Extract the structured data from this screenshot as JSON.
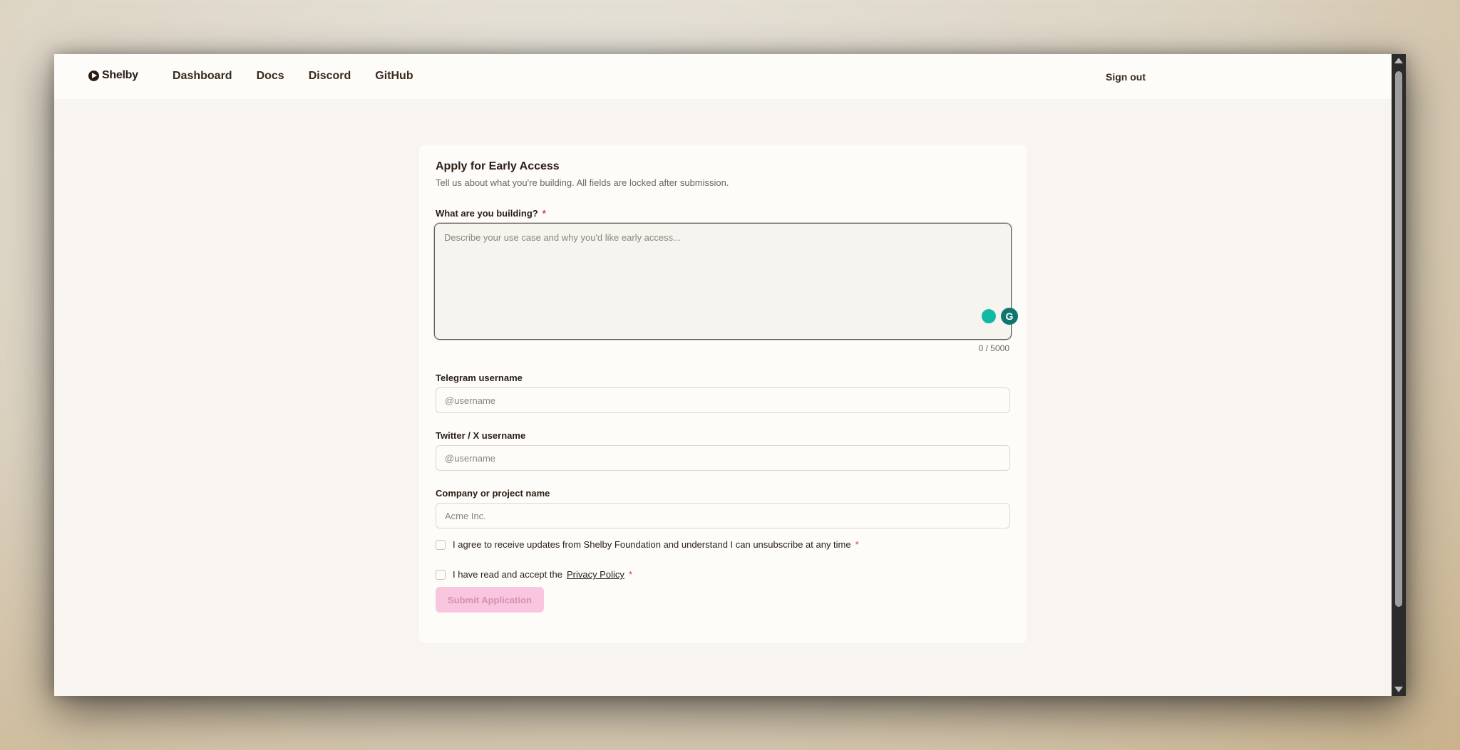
{
  "nav": {
    "brand": "Shelby",
    "links": [
      "Dashboard",
      "Docs",
      "Discord",
      "GitHub"
    ],
    "sign_out": "Sign out"
  },
  "form": {
    "title": "Apply for Early Access",
    "subtitle": "Tell us about what you're building. All fields are locked after submission.",
    "building": {
      "label": "What are you building?",
      "required_mark": "*",
      "placeholder": "Describe your use case and why you'd like early access...",
      "value": "",
      "counter": "0 / 5000"
    },
    "telegram": {
      "label": "Telegram username",
      "placeholder": "@username",
      "value": ""
    },
    "twitter": {
      "label": "Twitter / X username",
      "placeholder": "@username",
      "value": ""
    },
    "company": {
      "label": "Company or project name",
      "placeholder": "Acme Inc.",
      "value": ""
    },
    "consent_updates": {
      "text": "I agree to receive updates from Shelby Foundation and understand I can unsubscribe at any time",
      "required_mark": "*"
    },
    "consent_privacy": {
      "text": "I have read and accept the",
      "link": "Privacy Policy",
      "required_mark": "*"
    },
    "submit_label": "Submit Application",
    "grammarly_letter": "G"
  },
  "colors": {
    "accent_disabled": "#f9c6e0",
    "required": "#d63a3a",
    "page_bg": "#f8f5f0",
    "card_bg": "#fdfcf9"
  }
}
